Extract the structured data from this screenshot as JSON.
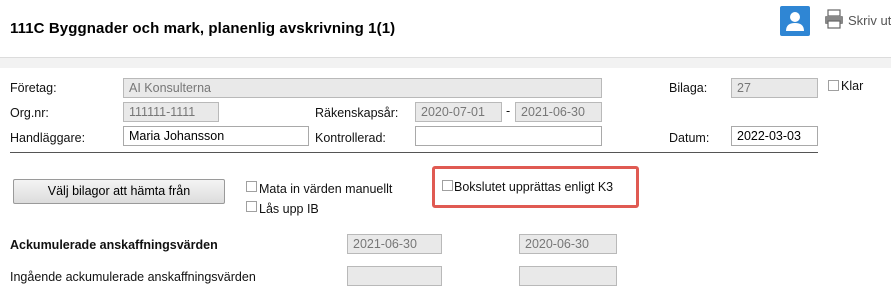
{
  "header": {
    "title": "111C  Byggnader och mark, planenlig avskrivning  1(1)",
    "print_label": "Skriv ut"
  },
  "form": {
    "company_label": "Företag:",
    "company_value": "AI Konsulterna",
    "attachment_label": "Bilaga:",
    "attachment_value": "27",
    "done_label": "Klar",
    "orgnr_label": "Org.nr:",
    "orgnr_value": "111111-1111",
    "fiscal_year_label": "Räkenskapsår:",
    "fiscal_year_from": "2020-07-01",
    "fiscal_year_dash": "-",
    "fiscal_year_to": "2021-06-30",
    "handler_label": "Handläggare:",
    "handler_value": "Maria Johansson",
    "checked_by_label": "Kontrollerad:",
    "checked_by_value": "",
    "date_label": "Datum:",
    "date_value": "2022-03-03"
  },
  "actions": {
    "choose_attachments_button": "Välj bilagor att hämta från",
    "manual_entry_label": "Mata in värden manuellt",
    "unlock_ib_label": "Lås upp IB",
    "k3_label": "Bokslutet upprättas enligt K3"
  },
  "section": {
    "heading": "Ackumulerade anskaffningsvärden",
    "col1_date": "2021-06-30",
    "col2_date": "2020-06-30",
    "row1_label": "Ingående ackumulerade anskaffningsvärden",
    "row1_col1": "",
    "row1_col2": ""
  },
  "colors": {
    "highlight": "#e05a52",
    "user_icon": "#2f86d4"
  },
  "icons": [
    "user-icon",
    "printer-icon"
  ]
}
